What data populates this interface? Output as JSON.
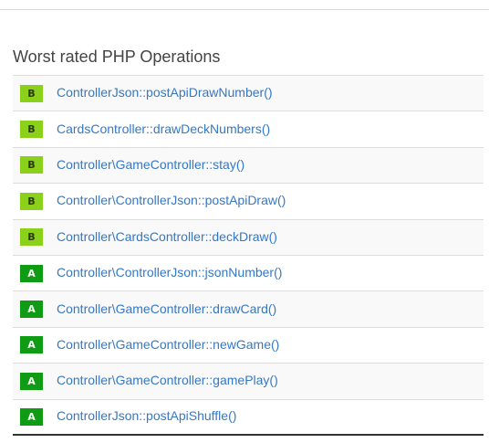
{
  "section": {
    "title": "Worst rated PHP Operations"
  },
  "colors": {
    "grade_B": "#8bd11c",
    "grade_A": "#0f9b14",
    "link": "#3478c6",
    "title": "#444444"
  },
  "operations": [
    {
      "grade": "B",
      "name": "ControllerJson::postApiDrawNumber()"
    },
    {
      "grade": "B",
      "name": "CardsController::drawDeckNumbers()"
    },
    {
      "grade": "B",
      "name": "Controller\\GameController::stay()"
    },
    {
      "grade": "B",
      "name": "Controller\\ControllerJson::postApiDraw()"
    },
    {
      "grade": "B",
      "name": "Controller\\CardsController::deckDraw()"
    },
    {
      "grade": "A",
      "name": "Controller\\ControllerJson::jsonNumber()"
    },
    {
      "grade": "A",
      "name": "Controller\\GameController::drawCard()"
    },
    {
      "grade": "A",
      "name": "Controller\\GameController::newGame()"
    },
    {
      "grade": "A",
      "name": "Controller\\GameController::gamePlay()"
    },
    {
      "grade": "A",
      "name": "ControllerJson::postApiShuffle()"
    }
  ]
}
